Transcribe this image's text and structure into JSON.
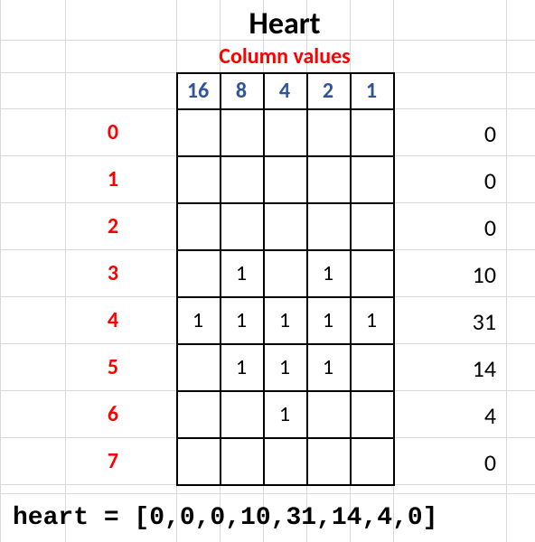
{
  "title": "Heart",
  "subtitle": "Column values",
  "column_headers": [
    "16",
    "8",
    "4",
    "2",
    "1"
  ],
  "row_labels": [
    "0",
    "1",
    "2",
    "3",
    "4",
    "5",
    "6",
    "7"
  ],
  "grid": [
    [
      "",
      "",
      "",
      "",
      ""
    ],
    [
      "",
      "",
      "",
      "",
      ""
    ],
    [
      "",
      "",
      "",
      "",
      ""
    ],
    [
      "",
      "1",
      "",
      "1",
      ""
    ],
    [
      "1",
      "1",
      "1",
      "1",
      "1"
    ],
    [
      "",
      "1",
      "1",
      "1",
      ""
    ],
    [
      "",
      "",
      "1",
      "",
      ""
    ],
    [
      "",
      "",
      "",
      "",
      ""
    ]
  ],
  "sums": [
    "0",
    "0",
    "0",
    "10",
    "31",
    "14",
    "4",
    "0"
  ],
  "code_line": "heart = [0,0,0,10,31,14,4,0]"
}
